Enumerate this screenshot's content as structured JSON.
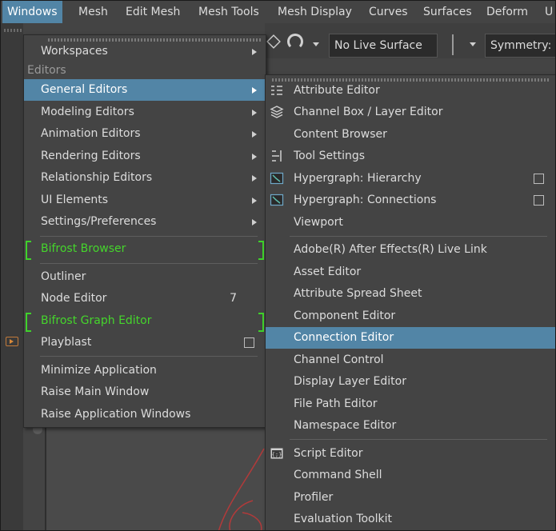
{
  "menubar": {
    "items": [
      {
        "label": "Windows",
        "active": true
      },
      {
        "label": "Mesh"
      },
      {
        "label": "Edit Mesh"
      },
      {
        "label": "Mesh Tools"
      },
      {
        "label": "Mesh Display"
      },
      {
        "label": "Curves"
      },
      {
        "label": "Surfaces"
      },
      {
        "label": "Deform"
      },
      {
        "label": "U"
      }
    ]
  },
  "toolbar": {
    "live_surface": "No Live Surface",
    "symmetry": "Symmetry: C"
  },
  "windows_menu": {
    "workspaces": "Workspaces",
    "editors_header": "Editors",
    "general_editors": "General Editors",
    "modeling_editors": "Modeling Editors",
    "animation_editors": "Animation Editors",
    "rendering_editors": "Rendering Editors",
    "relationship_editors": "Relationship Editors",
    "ui_elements": "UI Elements",
    "settings_preferences": "Settings/Preferences",
    "bifrost_browser": "Bifrost Browser",
    "outliner": "Outliner",
    "node_editor": "Node Editor",
    "node_editor_shortcut": "7",
    "bifrost_graph_editor": "Bifrost Graph Editor",
    "playblast": "Playblast",
    "minimize_application": "Minimize Application",
    "raise_main_window": "Raise Main Window",
    "raise_application_windows": "Raise Application Windows"
  },
  "general_editors_menu": {
    "attribute_editor": "Attribute Editor",
    "channel_box_layer_editor": "Channel Box / Layer Editor",
    "content_browser": "Content Browser",
    "tool_settings": "Tool Settings",
    "hypergraph_hierarchy": "Hypergraph: Hierarchy",
    "hypergraph_connections": "Hypergraph: Connections",
    "viewport": "Viewport",
    "after_effects_live_link": "Adobe(R) After Effects(R) Live Link",
    "asset_editor": "Asset Editor",
    "attribute_spread_sheet": "Attribute Spread Sheet",
    "component_editor": "Component Editor",
    "connection_editor": "Connection Editor",
    "channel_control": "Channel Control",
    "display_layer_editor": "Display Layer Editor",
    "file_path_editor": "File Path Editor",
    "namespace_editor": "Namespace Editor",
    "script_editor": "Script Editor",
    "command_shell": "Command Shell",
    "profiler": "Profiler",
    "evaluation_toolkit": "Evaluation Toolkit"
  },
  "colors": {
    "highlight": "#5285a6",
    "bifrost_green": "#45d52c",
    "menu_bg": "#444444"
  }
}
